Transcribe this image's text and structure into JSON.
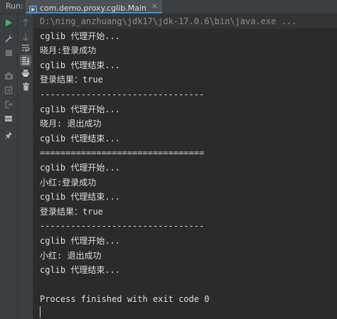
{
  "run_label": "Run:",
  "tab": {
    "title": "com.demo.proxy.cglib.Main",
    "close_glyph": "×",
    "icon": "run-config-icon"
  },
  "toolbar_left": [
    {
      "name": "rerun-icon",
      "color": "#59a869"
    },
    {
      "name": "wrench-icon",
      "color": "#afb1b3"
    },
    {
      "name": "stop-icon",
      "color": "#6e6e6e"
    },
    {
      "name": "camera-icon",
      "color": "#6e6e6e"
    },
    {
      "name": "login-icon",
      "color": "#6e6e6e"
    },
    {
      "name": "exit-icon",
      "color": "#6e6e6e"
    },
    {
      "name": "layout-icon",
      "color": "#afb1b3"
    },
    {
      "name": "pin-icon",
      "color": "#afb1b3"
    }
  ],
  "toolbar_right": [
    {
      "name": "arrow-up-icon"
    },
    {
      "name": "arrow-down-icon"
    },
    {
      "name": "soft-wrap-icon"
    },
    {
      "name": "scroll-to-end-icon"
    },
    {
      "name": "print-icon"
    },
    {
      "name": "trash-icon"
    }
  ],
  "console": {
    "command": "D:\\ning_anzhuang\\jdk17\\jdk-17.0.6\\bin\\java.exe ...",
    "lines": [
      "cglib 代理开始...",
      "晓月:登录成功",
      "cglib 代理结束...",
      "登录结果：true",
      "--------------------------------",
      "cglib 代理开始...",
      "晓月: 退出成功",
      "cglib 代理结束...",
      "================================",
      "cglib 代理开始...",
      "小红:登录成功",
      "cglib 代理结束...",
      "登录结果：true",
      "--------------------------------",
      "cglib 代理开始...",
      "小红: 退出成功",
      "cglib 代理结束...",
      "",
      "Process finished with exit code 0"
    ]
  }
}
